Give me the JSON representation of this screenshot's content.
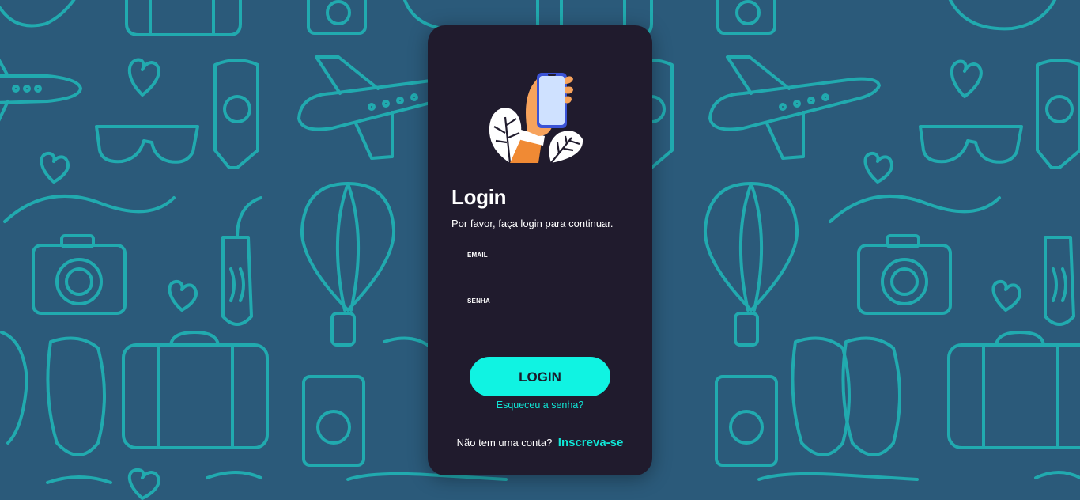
{
  "background": {
    "color": "#2b5a7a",
    "pattern_color": "#20b9b9",
    "pattern_icons": [
      "airplane-icon",
      "heart-icon",
      "sunglasses-icon",
      "sunscreen-icon",
      "camera-icon",
      "hot-air-balloon-icon",
      "luggage-tag-icon",
      "flip-flops-icon",
      "suitcase-icon",
      "passport-icon",
      "plant-icon"
    ]
  },
  "card": {
    "background": "#201b2d",
    "illustration": "hand-holding-phone-icon"
  },
  "login": {
    "title": "Login",
    "subtitle": "Por favor, faça login para continuar.",
    "email_label": "EMAIL",
    "email_value": "",
    "password_label": "SENHA",
    "password_value": "",
    "button_label": "LOGIN",
    "forgot_label": "Esqueceu a senha?",
    "no_account_text": "Não tem uma conta?",
    "signup_label": "Inscreva-se"
  },
  "colors": {
    "accent": "#10f3e2",
    "link": "#10e6d6",
    "text": "#ffffff"
  }
}
